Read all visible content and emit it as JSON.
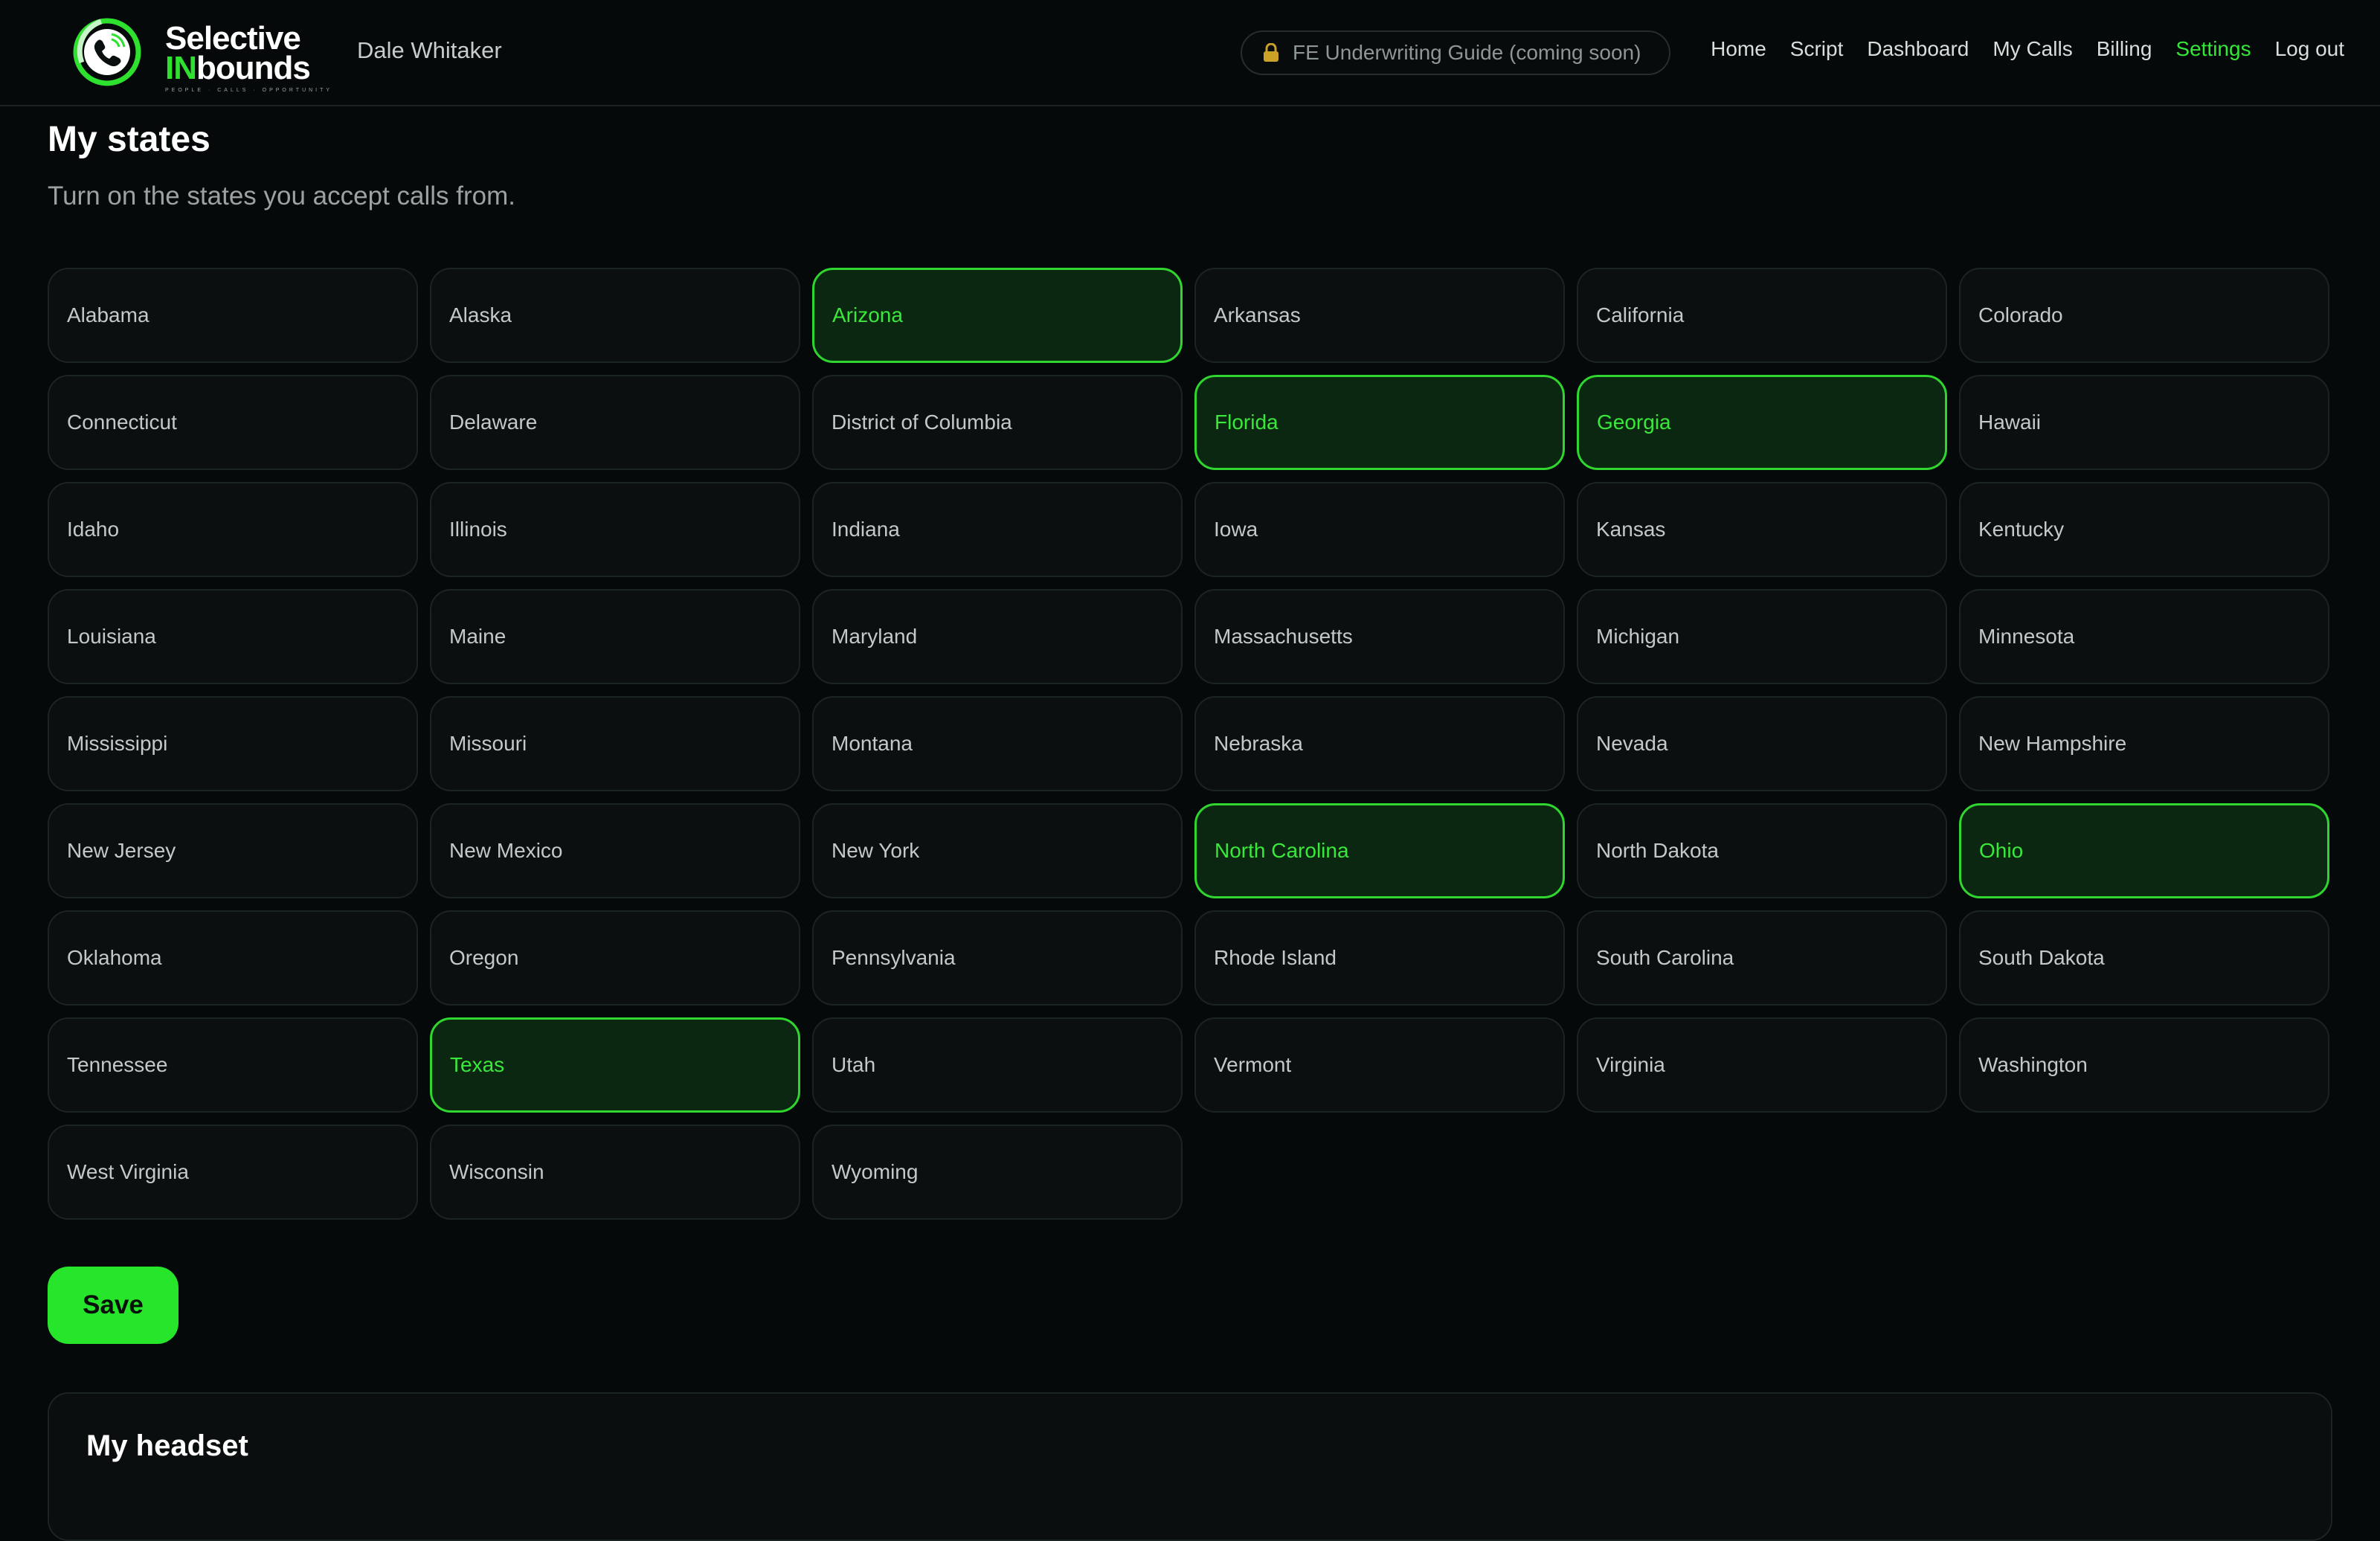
{
  "header": {
    "brand_line1": "Selective",
    "brand_line2_highlight": "IN",
    "brand_line2_rest": "bounds",
    "brand_tagline": "PEOPLE · CALLS · OPPORTUNITY",
    "username": "Dale Whitaker",
    "guide_label": "FE Underwriting Guide (coming soon)",
    "nav": [
      {
        "label": "Home",
        "active": false
      },
      {
        "label": "Script",
        "active": false
      },
      {
        "label": "Dashboard",
        "active": false
      },
      {
        "label": "My Calls",
        "active": false
      },
      {
        "label": "Billing",
        "active": false
      },
      {
        "label": "Settings",
        "active": true
      },
      {
        "label": "Log out",
        "active": false
      }
    ]
  },
  "states_section": {
    "title": "My states",
    "subtitle": "Turn on the states you accept calls from.",
    "states": [
      {
        "name": "Alabama",
        "selected": false
      },
      {
        "name": "Alaska",
        "selected": false
      },
      {
        "name": "Arizona",
        "selected": true
      },
      {
        "name": "Arkansas",
        "selected": false
      },
      {
        "name": "California",
        "selected": false
      },
      {
        "name": "Colorado",
        "selected": false
      },
      {
        "name": "Connecticut",
        "selected": false
      },
      {
        "name": "Delaware",
        "selected": false
      },
      {
        "name": "District of Columbia",
        "selected": false
      },
      {
        "name": "Florida",
        "selected": true
      },
      {
        "name": "Georgia",
        "selected": true
      },
      {
        "name": "Hawaii",
        "selected": false
      },
      {
        "name": "Idaho",
        "selected": false
      },
      {
        "name": "Illinois",
        "selected": false
      },
      {
        "name": "Indiana",
        "selected": false
      },
      {
        "name": "Iowa",
        "selected": false
      },
      {
        "name": "Kansas",
        "selected": false
      },
      {
        "name": "Kentucky",
        "selected": false
      },
      {
        "name": "Louisiana",
        "selected": false
      },
      {
        "name": "Maine",
        "selected": false
      },
      {
        "name": "Maryland",
        "selected": false
      },
      {
        "name": "Massachusetts",
        "selected": false
      },
      {
        "name": "Michigan",
        "selected": false
      },
      {
        "name": "Minnesota",
        "selected": false
      },
      {
        "name": "Mississippi",
        "selected": false
      },
      {
        "name": "Missouri",
        "selected": false
      },
      {
        "name": "Montana",
        "selected": false
      },
      {
        "name": "Nebraska",
        "selected": false
      },
      {
        "name": "Nevada",
        "selected": false
      },
      {
        "name": "New Hampshire",
        "selected": false
      },
      {
        "name": "New Jersey",
        "selected": false
      },
      {
        "name": "New Mexico",
        "selected": false
      },
      {
        "name": "New York",
        "selected": false
      },
      {
        "name": "North Carolina",
        "selected": true
      },
      {
        "name": "North Dakota",
        "selected": false
      },
      {
        "name": "Ohio",
        "selected": true
      },
      {
        "name": "Oklahoma",
        "selected": false
      },
      {
        "name": "Oregon",
        "selected": false
      },
      {
        "name": "Pennsylvania",
        "selected": false
      },
      {
        "name": "Rhode Island",
        "selected": false
      },
      {
        "name": "South Carolina",
        "selected": false
      },
      {
        "name": "South Dakota",
        "selected": false
      },
      {
        "name": "Tennessee",
        "selected": false
      },
      {
        "name": "Texas",
        "selected": true
      },
      {
        "name": "Utah",
        "selected": false
      },
      {
        "name": "Vermont",
        "selected": false
      },
      {
        "name": "Virginia",
        "selected": false
      },
      {
        "name": "Washington",
        "selected": false
      },
      {
        "name": "West Virginia",
        "selected": false
      },
      {
        "name": "Wisconsin",
        "selected": false
      },
      {
        "name": "Wyoming",
        "selected": false
      }
    ],
    "save_label": "Save"
  },
  "headset_section": {
    "title": "My headset"
  },
  "icons": {
    "logo": "phone-logo-icon",
    "guide": "lock-icon"
  },
  "colors": {
    "accent": "#2fe12f",
    "background": "#050909",
    "selected_fill": "#0c2711"
  }
}
